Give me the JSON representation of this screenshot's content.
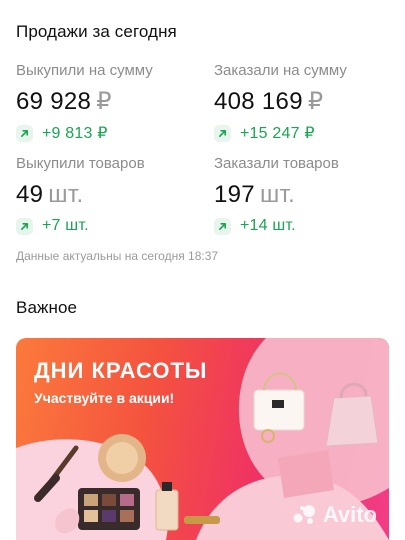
{
  "sales": {
    "title": "Продажи за сегодня",
    "bought_sum": {
      "label": "Выкупили на сумму",
      "value": "69 928",
      "unit": "₽",
      "delta": "+9 813 ₽"
    },
    "ordered_sum": {
      "label": "Заказали на сумму",
      "value": "408 169",
      "unit": "₽",
      "delta": "+15 247 ₽"
    },
    "bought_qty": {
      "label": "Выкупили товаров",
      "value": "49",
      "unit": "шт.",
      "delta": "+7 шт."
    },
    "ordered_qty": {
      "label": "Заказали товаров",
      "value": "197",
      "unit": "шт.",
      "delta": "+14 шт."
    },
    "freshness": "Данные актуальны на сегодня 18:37",
    "delta_color": "#1aa553"
  },
  "important": {
    "title": "Важное",
    "banner": {
      "title": "ДНИ КРАСОТЫ",
      "subtitle": "Участвуйте в акции!",
      "watermark": "Avito"
    }
  }
}
